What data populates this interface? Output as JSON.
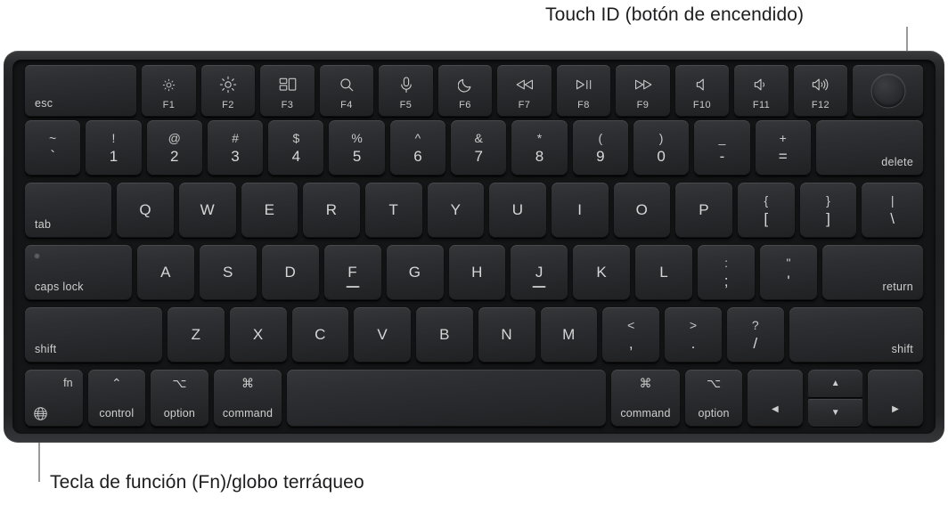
{
  "callouts": {
    "touch_id": "Touch ID (botón de encendido)",
    "fn_key": "Tecla de función (Fn)/globo terráqueo"
  },
  "colors": {
    "page_background": "#ffffff",
    "text": "#1d1d1f",
    "leader_line": "#9a9a9a",
    "keyboard_chassis": "#232426",
    "key_face": "#2c2d30",
    "key_legend": "#d6d6d6"
  },
  "keyboard": {
    "layout": "US English, 78-key MacBook Magic Keyboard with Touch ID",
    "rows": {
      "function_row": [
        {
          "name": "escape",
          "label": "esc",
          "fn": "",
          "icon": ""
        },
        {
          "name": "f1",
          "label": "",
          "fn": "F1",
          "icon": "brightness-down-icon"
        },
        {
          "name": "f2",
          "label": "",
          "fn": "F2",
          "icon": "brightness-up-icon"
        },
        {
          "name": "f3",
          "label": "",
          "fn": "F3",
          "icon": "mission-control-icon"
        },
        {
          "name": "f4",
          "label": "",
          "fn": "F4",
          "icon": "spotlight-search-icon"
        },
        {
          "name": "f5",
          "label": "",
          "fn": "F5",
          "icon": "dictation-microphone-icon"
        },
        {
          "name": "f6",
          "label": "",
          "fn": "F6",
          "icon": "do-not-disturb-moon-icon"
        },
        {
          "name": "f7",
          "label": "",
          "fn": "F7",
          "icon": "rewind-icon"
        },
        {
          "name": "f8",
          "label": "",
          "fn": "F8",
          "icon": "play-pause-icon"
        },
        {
          "name": "f9",
          "label": "",
          "fn": "F9",
          "icon": "fast-forward-icon"
        },
        {
          "name": "f10",
          "label": "",
          "fn": "F10",
          "icon": "volume-mute-icon"
        },
        {
          "name": "f11",
          "label": "",
          "fn": "F11",
          "icon": "volume-down-icon"
        },
        {
          "name": "f12",
          "label": "",
          "fn": "F12",
          "icon": "volume-up-icon"
        },
        {
          "name": "touch-id",
          "label": "",
          "fn": "",
          "icon": "touch-id-power-button"
        }
      ],
      "number_row": [
        {
          "name": "grave",
          "upper": "~",
          "lower": "`"
        },
        {
          "name": "digit-1",
          "upper": "!",
          "lower": "1"
        },
        {
          "name": "digit-2",
          "upper": "@",
          "lower": "2"
        },
        {
          "name": "digit-3",
          "upper": "#",
          "lower": "3"
        },
        {
          "name": "digit-4",
          "upper": "$",
          "lower": "4"
        },
        {
          "name": "digit-5",
          "upper": "%",
          "lower": "5"
        },
        {
          "name": "digit-6",
          "upper": "^",
          "lower": "6"
        },
        {
          "name": "digit-7",
          "upper": "&",
          "lower": "7"
        },
        {
          "name": "digit-8",
          "upper": "*",
          "lower": "8"
        },
        {
          "name": "digit-9",
          "upper": "(",
          "lower": "9"
        },
        {
          "name": "digit-0",
          "upper": ")",
          "lower": "0"
        },
        {
          "name": "hyphen",
          "upper": "_",
          "lower": "-"
        },
        {
          "name": "equal",
          "upper": "+",
          "lower": "="
        },
        {
          "name": "delete",
          "upper": "",
          "lower": "",
          "corner": "delete"
        }
      ],
      "qwerty_row": [
        {
          "name": "tab",
          "corner": "tab"
        },
        {
          "name": "letter-q",
          "center": "Q"
        },
        {
          "name": "letter-w",
          "center": "W"
        },
        {
          "name": "letter-e",
          "center": "E"
        },
        {
          "name": "letter-r",
          "center": "R"
        },
        {
          "name": "letter-t",
          "center": "T"
        },
        {
          "name": "letter-y",
          "center": "Y"
        },
        {
          "name": "letter-u",
          "center": "U"
        },
        {
          "name": "letter-i",
          "center": "I"
        },
        {
          "name": "letter-o",
          "center": "O"
        },
        {
          "name": "letter-p",
          "center": "P"
        },
        {
          "name": "bracket-left",
          "upper": "{",
          "lower": "["
        },
        {
          "name": "bracket-right",
          "upper": "}",
          "lower": "]"
        },
        {
          "name": "backslash",
          "upper": "|",
          "lower": "\\"
        }
      ],
      "home_row": [
        {
          "name": "caps-lock",
          "corner": "caps lock"
        },
        {
          "name": "letter-a",
          "center": "A"
        },
        {
          "name": "letter-s",
          "center": "S"
        },
        {
          "name": "letter-d",
          "center": "D"
        },
        {
          "name": "letter-f",
          "center": "F",
          "home_bar": true
        },
        {
          "name": "letter-g",
          "center": "G"
        },
        {
          "name": "letter-h",
          "center": "H"
        },
        {
          "name": "letter-j",
          "center": "J",
          "home_bar": true
        },
        {
          "name": "letter-k",
          "center": "K"
        },
        {
          "name": "letter-l",
          "center": "L"
        },
        {
          "name": "semicolon",
          "upper": ":",
          "lower": ";"
        },
        {
          "name": "quote",
          "upper": "\"",
          "lower": "'"
        },
        {
          "name": "return",
          "corner": "return"
        }
      ],
      "shift_row": [
        {
          "name": "shift-left",
          "corner": "shift"
        },
        {
          "name": "letter-z",
          "center": "Z"
        },
        {
          "name": "letter-x",
          "center": "X"
        },
        {
          "name": "letter-c",
          "center": "C"
        },
        {
          "name": "letter-v",
          "center": "V"
        },
        {
          "name": "letter-b",
          "center": "B"
        },
        {
          "name": "letter-n",
          "center": "N"
        },
        {
          "name": "letter-m",
          "center": "M"
        },
        {
          "name": "comma",
          "upper": "<",
          "lower": ","
        },
        {
          "name": "period",
          "upper": ">",
          "lower": "."
        },
        {
          "name": "slash",
          "upper": "?",
          "lower": "/"
        },
        {
          "name": "shift-right",
          "corner": "shift"
        }
      ],
      "bottom_row": [
        {
          "name": "fn-globe",
          "word": "fn",
          "icon": "globe-icon"
        },
        {
          "name": "control-left",
          "word": "control",
          "symbol": "⌃"
        },
        {
          "name": "option-left",
          "word": "option",
          "symbol": "⌥"
        },
        {
          "name": "command-left",
          "word": "command",
          "symbol": "⌘"
        },
        {
          "name": "space",
          "word": "",
          "symbol": ""
        },
        {
          "name": "command-right",
          "word": "command",
          "symbol": "⌘"
        },
        {
          "name": "option-right",
          "word": "option",
          "symbol": "⌥"
        },
        {
          "name": "arrow-left",
          "symbol": "◀"
        },
        {
          "name": "arrow-up",
          "symbol": "▲"
        },
        {
          "name": "arrow-down",
          "symbol": "▼"
        },
        {
          "name": "arrow-right",
          "symbol": "▶"
        }
      ]
    }
  }
}
